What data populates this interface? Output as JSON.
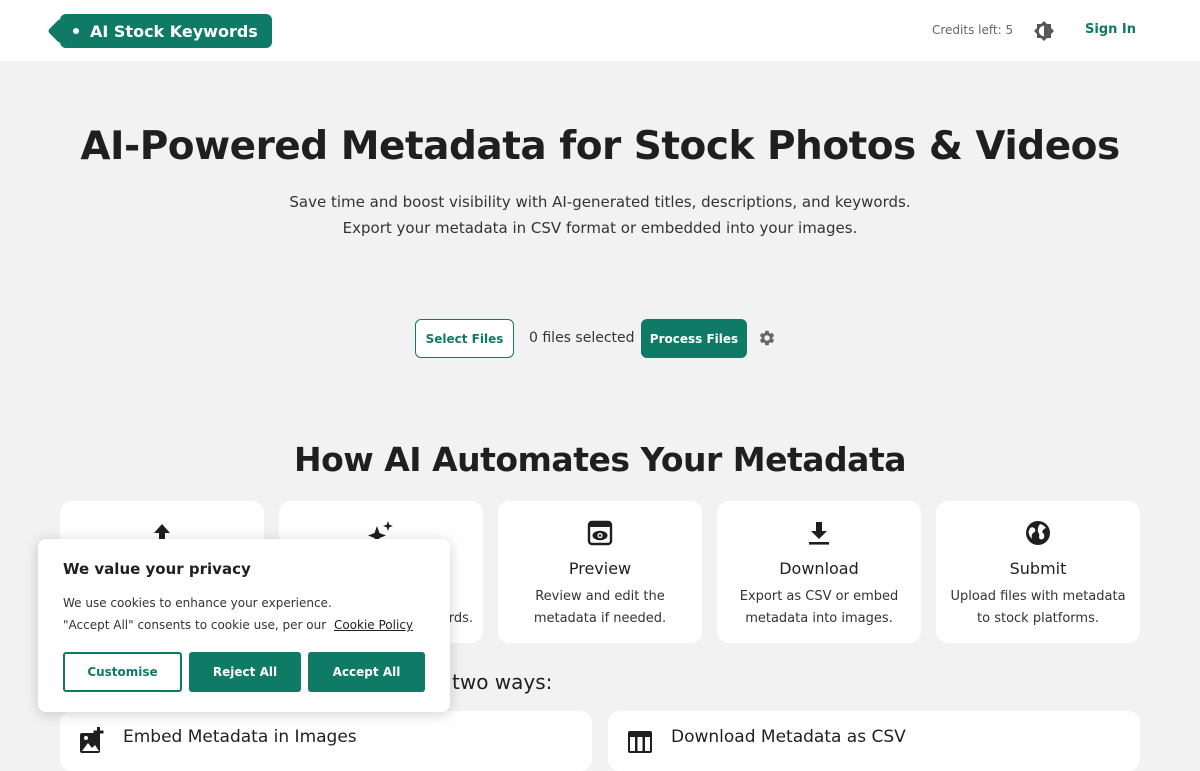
{
  "header": {
    "logo_text": "AI Stock Keywords",
    "credits": "Credits left: 5",
    "theme_icon": "half-circle-sun-icon",
    "signin_label": "Sign In"
  },
  "hero": {
    "title": "AI-Powered Metadata for Stock Photos & Videos",
    "subtitle_line1": "Save time and boost visibility with AI-generated titles, descriptions, and keywords.",
    "subtitle_line2": "Export your metadata in CSV format or embedded into your images."
  },
  "upload": {
    "select_label": "Select Files",
    "files_selected": "0 files selected",
    "process_label": "Process Files",
    "settings_icon": "gear-icon"
  },
  "how": {
    "title": "How AI Automates Your Metadata",
    "steps": [
      {
        "icon": "upload-arrow-icon",
        "title": "",
        "desc": ""
      },
      {
        "icon": "sparkles-icon",
        "title": "",
        "desc": "rds."
      },
      {
        "icon": "preview-eye-icon",
        "title": "Preview",
        "desc": "Review and edit the metadata if needed."
      },
      {
        "icon": "download-icon",
        "title": "Download",
        "desc": "Export as CSV or embed metadata into images."
      },
      {
        "icon": "globe-icon",
        "title": "Submit",
        "desc": "Upload files with metadata to stock platforms."
      }
    ],
    "ways_text": "two ways:"
  },
  "options": [
    {
      "icon": "image-add-icon",
      "title": "Embed Metadata in Images"
    },
    {
      "icon": "table-icon",
      "title": "Download Metadata as CSV"
    }
  ],
  "cookie": {
    "title": "We value your privacy",
    "text1": "We use cookies to enhance your experience.",
    "text2": "\"Accept All\" consents to cookie use, per our",
    "link": "Cookie Policy",
    "customise": "Customise",
    "reject": "Reject All",
    "accept": "Accept All"
  },
  "colors": {
    "accent": "#0f7a66",
    "background": "#f2f2f2"
  }
}
